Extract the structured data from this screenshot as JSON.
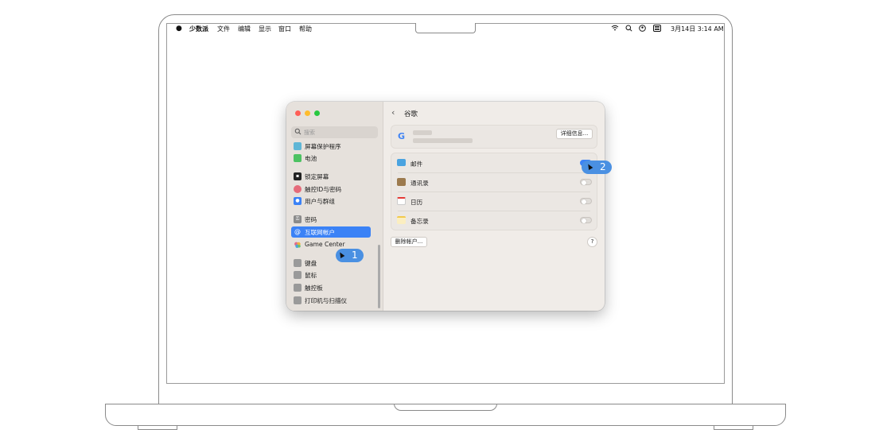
{
  "menubar": {
    "apple": "",
    "app_name": "少数派",
    "menus": [
      "文件",
      "编辑",
      "显示",
      "窗口",
      "帮助"
    ],
    "datetime": "3月14日  3:14 AM"
  },
  "search": {
    "placeholder": "搜索"
  },
  "sidebar": {
    "items": [
      {
        "label": "屏幕保护程序",
        "icon": "screensaver-icon",
        "color": "#5fb6d6"
      },
      {
        "label": "电池",
        "icon": "battery-icon",
        "color": "#4cc262"
      },
      {
        "label": "锁定屏幕",
        "icon": "lock-icon",
        "color": "#222222"
      },
      {
        "label": "触控ID与密码",
        "icon": "fingerprint-icon",
        "color": "#e56b7a"
      },
      {
        "label": "用户与群组",
        "icon": "users-icon",
        "color": "#3b82f6"
      },
      {
        "label": "密码",
        "icon": "key-icon",
        "color": "#8a8a8a"
      },
      {
        "label": "互联网帐户",
        "icon": "at-icon",
        "color": "#3b82f6"
      },
      {
        "label": "Game Center",
        "icon": "game-center-icon",
        "color": "#e26a8b"
      },
      {
        "label": "键盘",
        "icon": "keyboard-icon",
        "color": "#9a9a9a"
      },
      {
        "label": "鼠标",
        "icon": "mouse-icon",
        "color": "#9a9a9a"
      },
      {
        "label": "触控板",
        "icon": "trackpad-icon",
        "color": "#9a9a9a"
      },
      {
        "label": "打印机与扫描仪",
        "icon": "printer-icon",
        "color": "#9a9a9a"
      }
    ],
    "selected_index": 6
  },
  "content": {
    "title": "谷歌",
    "account_provider_logo": "G",
    "details_button": "详细信息...",
    "services": [
      {
        "label": "邮件",
        "icon": "mail-icon",
        "enabled": true
      },
      {
        "label": "通讯录",
        "icon": "contacts-icon",
        "enabled": false
      },
      {
        "label": "日历",
        "icon": "calendar-icon",
        "enabled": false
      },
      {
        "label": "备忘录",
        "icon": "notes-icon",
        "enabled": false
      }
    ],
    "delete_button": "删除帐户...",
    "help_button": "?"
  },
  "callouts": {
    "first": "1",
    "second": "2"
  },
  "colors": {
    "accent": "#3b82f6",
    "callout": "#4a90e2"
  }
}
